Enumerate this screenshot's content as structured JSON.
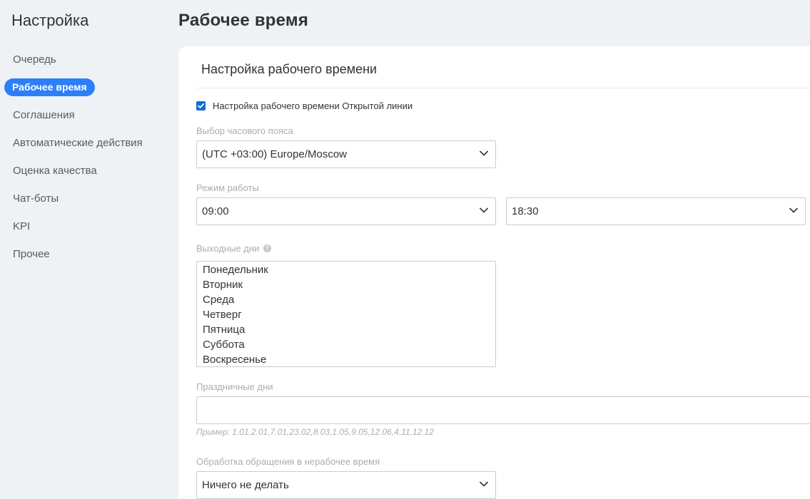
{
  "sidebar": {
    "title": "Настройка",
    "items": [
      {
        "label": "Очередь",
        "active": false
      },
      {
        "label": "Рабочее время",
        "active": true
      },
      {
        "label": "Соглашения",
        "active": false
      },
      {
        "label": "Автоматические действия",
        "active": false
      },
      {
        "label": "Оценка качества",
        "active": false
      },
      {
        "label": "Чат-боты",
        "active": false
      },
      {
        "label": "KPI",
        "active": false
      },
      {
        "label": "Прочее",
        "active": false
      }
    ]
  },
  "page": {
    "title": "Рабочее время"
  },
  "panel": {
    "header": "Настройка рабочего времени",
    "enable_checkbox": {
      "label": "Настройка рабочего времени Открытой линии",
      "checked": true
    },
    "timezone": {
      "label": "Выбор часового пояса",
      "value": "(UTC +03:00) Europe/Moscow"
    },
    "work_mode": {
      "label": "Режим работы",
      "start": "09:00",
      "end": "18:30"
    },
    "days_off": {
      "label": "Выходные дни",
      "options": [
        "Понедельник",
        "Вторник",
        "Среда",
        "Четверг",
        "Пятница",
        "Суббота",
        "Воскресенье"
      ]
    },
    "holidays": {
      "label": "Праздничные дни",
      "value": "",
      "hint": "Пример: 1.01,2.01,7.01,23.02,8.03,1.05,9.05,12.06,4.11,12.12"
    },
    "off_hours": {
      "label": "Обработка обращения в нерабочее время",
      "value": "Ничего не делать"
    }
  },
  "colors": {
    "accent": "#2d7ff9",
    "checkbox": "#0b6fd5",
    "background": "#eef2f4"
  }
}
